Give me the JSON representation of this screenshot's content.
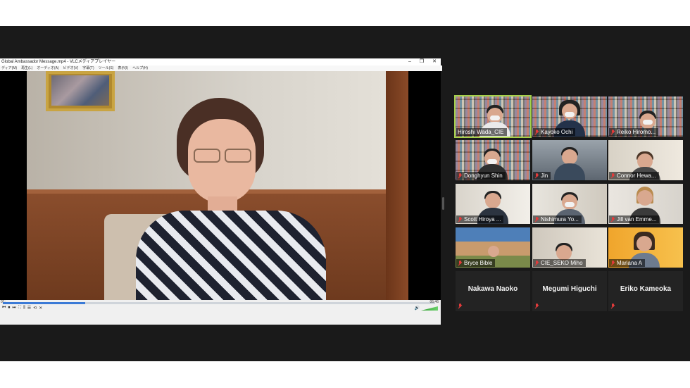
{
  "vlc": {
    "title": "Global Ambassador Message.mp4 - VLCメディアプレイヤー",
    "window_buttons": [
      "–",
      "❐",
      "✕"
    ],
    "menu": [
      "ディア(M)",
      "再生(L)",
      "オーディオ(A)",
      "ビデオ(V)",
      "字幕(T)",
      "ツール(S)",
      "表示(I)",
      "ヘルプ(H)"
    ],
    "time_elapsed": "01:",
    "time_total": "06:46",
    "progress": 0.19,
    "control_buttons": [
      "⏮",
      "⏹",
      "⏭",
      "⛶",
      "⫼",
      "☰",
      "⟲",
      "✕"
    ]
  },
  "participants": [
    {
      "name": "Hiroshi Wada_CIE",
      "muted": false,
      "active": true
    },
    {
      "name": "Kayoko Ochi",
      "muted": true,
      "active": false
    },
    {
      "name": "Reiko Hiromo...",
      "muted": true,
      "active": false
    },
    {
      "name": "Donghyun Shin",
      "muted": true,
      "active": false
    },
    {
      "name": "Jin",
      "muted": true,
      "active": false
    },
    {
      "name": "Connor Hewa...",
      "muted": true,
      "active": false
    },
    {
      "name": "Scott Hiroya ...",
      "muted": true,
      "active": false
    },
    {
      "name": "Nishimura Yo...",
      "muted": true,
      "active": false
    },
    {
      "name": "Jill van Emme...",
      "muted": true,
      "active": false
    },
    {
      "name": "Bryce Bible",
      "muted": true,
      "active": false
    },
    {
      "name": "CIE_SEKO Miho",
      "muted": true,
      "active": false
    },
    {
      "name": "Mariana A",
      "muted": true,
      "active": false
    }
  ],
  "name_only_participants": [
    {
      "name": "Nakawa Naoko"
    },
    {
      "name": "Megumi Higuchi"
    },
    {
      "name": "Eriko Kameoka"
    }
  ],
  "colors": {
    "active_speaker_border": "#a6d14a",
    "muted_icon": "#e23b3b",
    "zoom_bg": "#1a1a1a"
  }
}
